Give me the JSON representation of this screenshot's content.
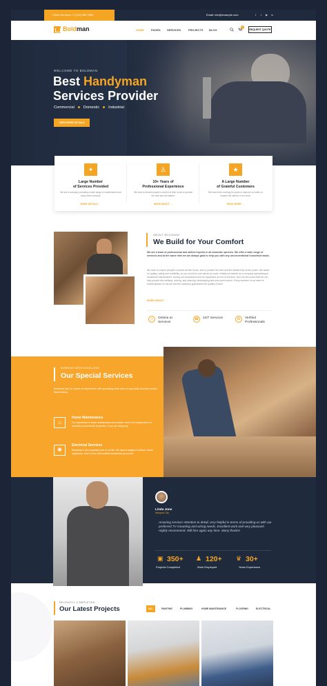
{
  "topbar": {
    "client_services": "Client Services: 1 (142) 456 7890",
    "email": "Email: info@example.com",
    "social": [
      "f",
      "t",
      "▶",
      "in"
    ]
  },
  "header": {
    "logo_main": "Bold",
    "logo_accent": "man",
    "nav": [
      "HOME",
      "PAGES",
      "SERVICES",
      "PROJECTS",
      "BLOG"
    ],
    "cart_count": "0",
    "quote_button": "REQUEST QUOTE"
  },
  "hero": {
    "welcome": "WELCOME TO BOLDMAN",
    "title_pre": "Best ",
    "title_accent": "Handyman",
    "title_line2": "Services Provider",
    "tags": [
      "Commercial",
      "Domestic",
      "Industrial"
    ],
    "button": "VIEW MORE DETAILS"
  },
  "features": [
    {
      "title": "Large Number\nof Services Provided",
      "desc": "We are a company providing a wide range of maintenance and many other services.",
      "more": "MORE DETAILS →",
      "icon": "tools-icon"
    },
    {
      "title": "10+ Years of\nProfessional Experience",
      "desc": "We work to ensure people's comfort at their home to provide the best and the fastest.",
      "more": "MORE ABOUT →",
      "icon": "person-icon"
    },
    {
      "title": "A Large Number\nof Grateful Customers",
      "desc": "We have been working for years to improve our skills, to expand the sphere of our work.",
      "more": "READ MORE →",
      "icon": "thumbs-up-icon"
    }
  ],
  "about": {
    "label": "ABOUT BOLDMAN",
    "title": "We Build for Your Comfort",
    "lead": "We are a team of professional and skilled experts in all domestic spheres. We offer a wide range of services and at the same time we are always glad to help you with any unconventional household tasks.",
    "body": "We work to ensure people's comfort at their home, and to provide the best and the fastest help at fair prices. We stand for quality, safety and credibility, so you could be sure about our work. Initially we started as a company specializing in household maintenance. During our successful work we expanded our list of services. Now we are proud that we can help people with welding, moving, any cleaning, landscaping and even pest control. Every member of our team is trained glazed on his job and the company guarantees the quality of work.",
    "more": "MORE ABOUT →",
    "stats": [
      {
        "icon": "clock-icon",
        "text": "Ontime at Services"
      },
      {
        "icon": "support-icon",
        "text": "24/7 Services"
      },
      {
        "icon": "award-icon",
        "text": "Verified Professionals"
      }
    ]
  },
  "services": {
    "label": "WORKING WITH EXCELLENT",
    "title": "Our Special Services",
    "intro": "Boldman has for years of experience with providing wide area of specialty services works listed below.",
    "items": [
      {
        "icon": "house-icon",
        "title": "Home Maintenance",
        "desc": "Our experience in home maintenance any surface, from Iron Constructions to upholstery commercial properties, if you are doing any."
      },
      {
        "icon": "bulb-icon",
        "title": "Electrical Services",
        "desc": "Electricity is very important part of our life. We cannot imagine it without. Home appliances, that is done with certified electricians personnel."
      }
    ]
  },
  "testimonial": {
    "name": "Linda Jone",
    "location": "Newyork City",
    "quote": "Amazing service! Attention to detail, very helpful in terms of providing us with our preferred TV mounting and wiring needs. Excellent work and very pleasant! Highly recommend. Will hire again any time. Many thanks!",
    "counters": [
      {
        "icon": "briefcase-icon",
        "number": "350+",
        "label": "Projects Completed"
      },
      {
        "icon": "workers-icon",
        "number": "120+",
        "label": "Work Employed"
      },
      {
        "icon": "trophy-icon",
        "number": "30+",
        "label": "Years Experiance"
      }
    ]
  },
  "projects": {
    "label": "RECENTLY COMPLETED",
    "title": "Our Latest Projects",
    "filters": [
      "ALL",
      "PAINTING",
      "PLUMBING",
      "HOME MAINTENANCE",
      "FLOORING",
      "ELECTRICAL"
    ]
  },
  "colors": {
    "accent": "#f5a524",
    "dark": "#1f2a3d",
    "background": "#1c2537"
  }
}
